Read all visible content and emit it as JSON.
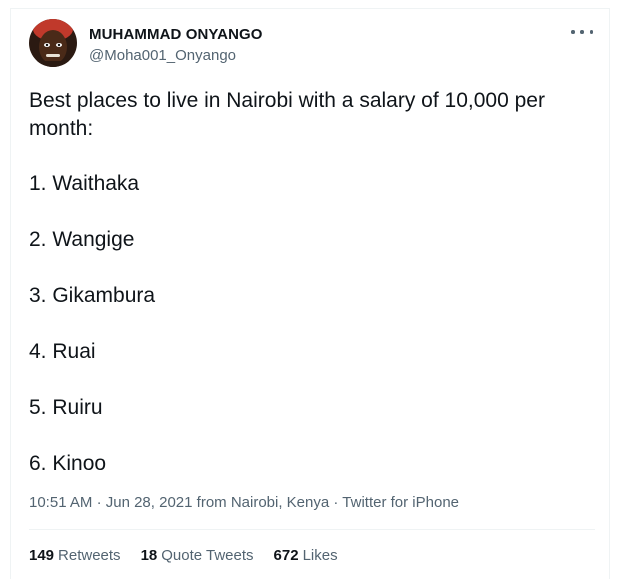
{
  "author": {
    "name": "MUHAMMAD ONYANGO",
    "handle": "@Moha001_Onyango"
  },
  "tweet": {
    "text": "Best places to live in Nairobi with a salary of 10,000 per month:",
    "list": [
      "1. Waithaka",
      "2. Wangige",
      "3. Gikambura",
      "4. Ruai",
      "5. Ruiru",
      "6. Kinoo"
    ]
  },
  "meta": {
    "time": "10:51 AM",
    "separator": "·",
    "date": "Jun 28, 2021",
    "location": "from Nairobi, Kenya",
    "source": "Twitter for iPhone"
  },
  "stats": {
    "retweets_count": "149",
    "retweets_label": "Retweets",
    "quotes_count": "18",
    "quotes_label": "Quote Tweets",
    "likes_count": "672",
    "likes_label": "Likes"
  },
  "icons": {
    "more": "more-icon",
    "avatar": "avatar"
  }
}
